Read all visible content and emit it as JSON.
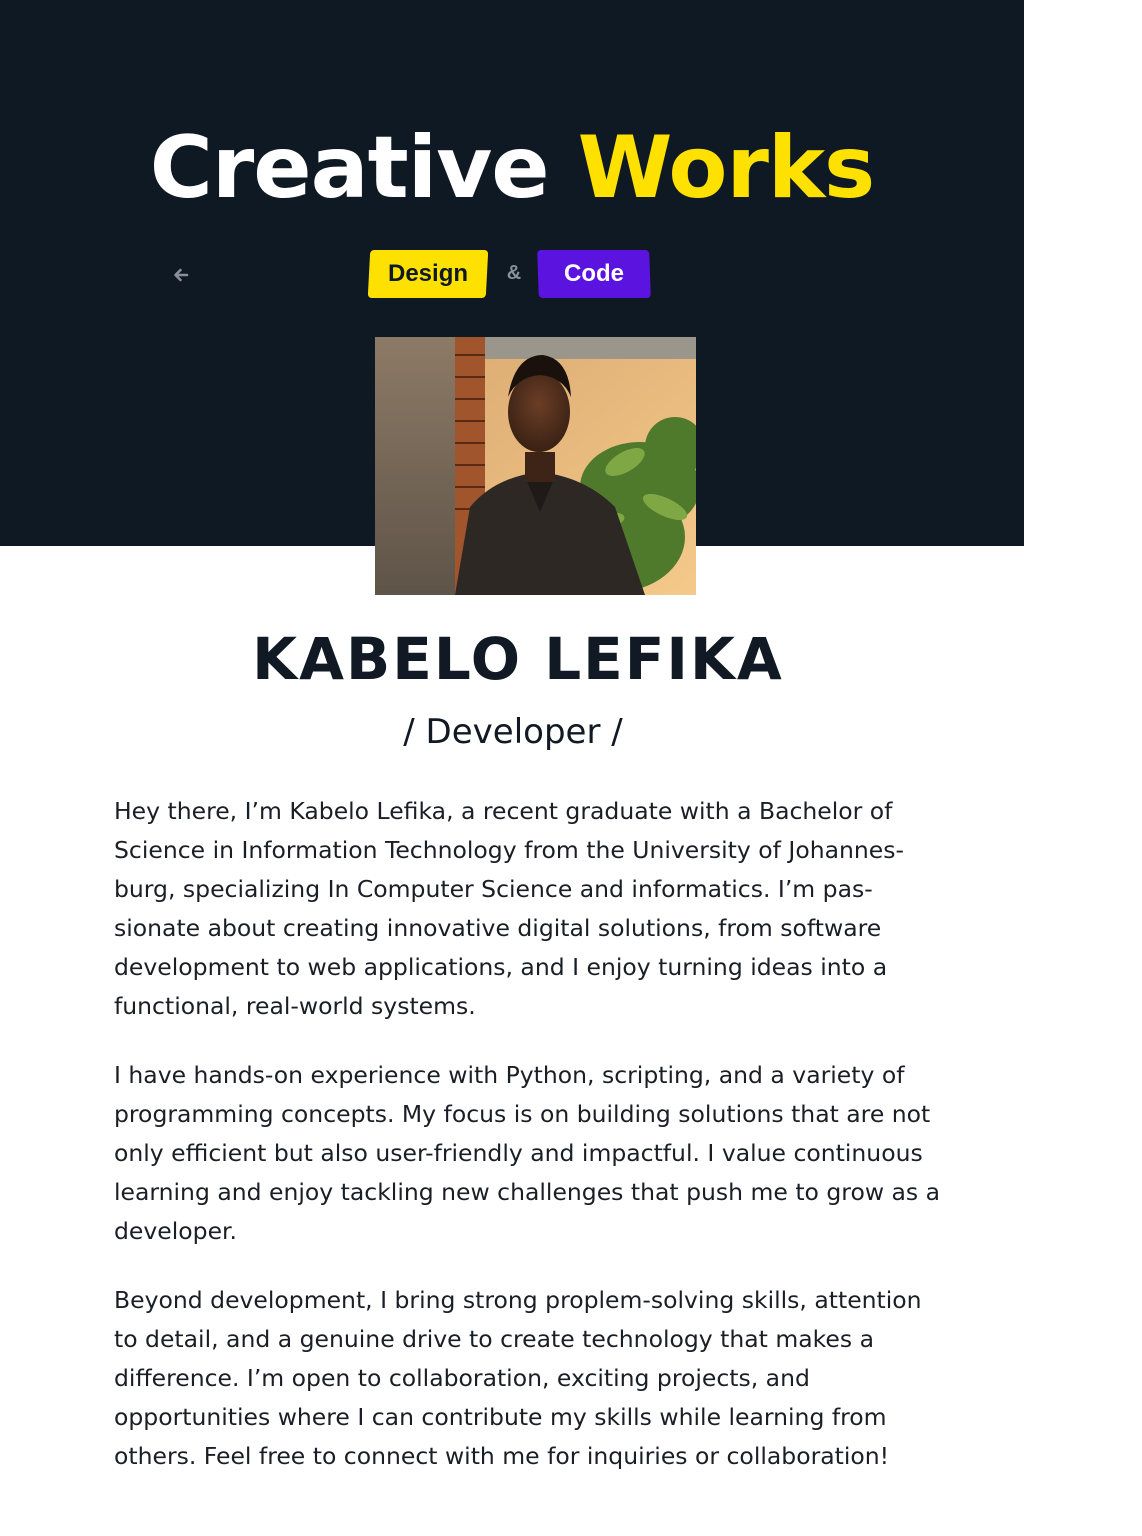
{
  "header": {
    "title_main": "Creative ",
    "title_accent": "Works",
    "back_icon": "arrow-left-icon",
    "badges": {
      "design": "Design",
      "ampersand": "&",
      "code": "Code"
    },
    "colors": {
      "background": "#0f1923",
      "accent": "#ffe100",
      "design_badge": "#ffe100",
      "code_badge": "#5b13e0"
    }
  },
  "profile": {
    "name": "KABELO LEFIKA",
    "role": "/ Developer /"
  },
  "about": {
    "paragraphs": [
      "Hey there, I’m Kabelo Lefika, a recent graduate with a Bachelor of Science in Information Technology from the University of Johannes­burg, specializing In Computer Science and informatics. I’m pas­sionate about creating innovative digital solutions, from software development to web applications, and I enjoy turning ideas into a functional, real-world systems.",
      "I have hands-on experience with Python, scripting, and a variety of programming concepts. My focus is on building solutions that are not only efficient but also user-friendly and impactful. I value continuous learning and enjoy tackling new challenges that push me to grow as a developer.",
      "Beyond development, I bring strong proplem-solving skills, atten­tion to detail, and a genuine drive to create technology that makes a difference. I’m open to collaboration, exciting projects, and opportunities where I can contribute my skills while learning from others. Feel free to connect with me for inquiries or collaboration!"
    ]
  }
}
